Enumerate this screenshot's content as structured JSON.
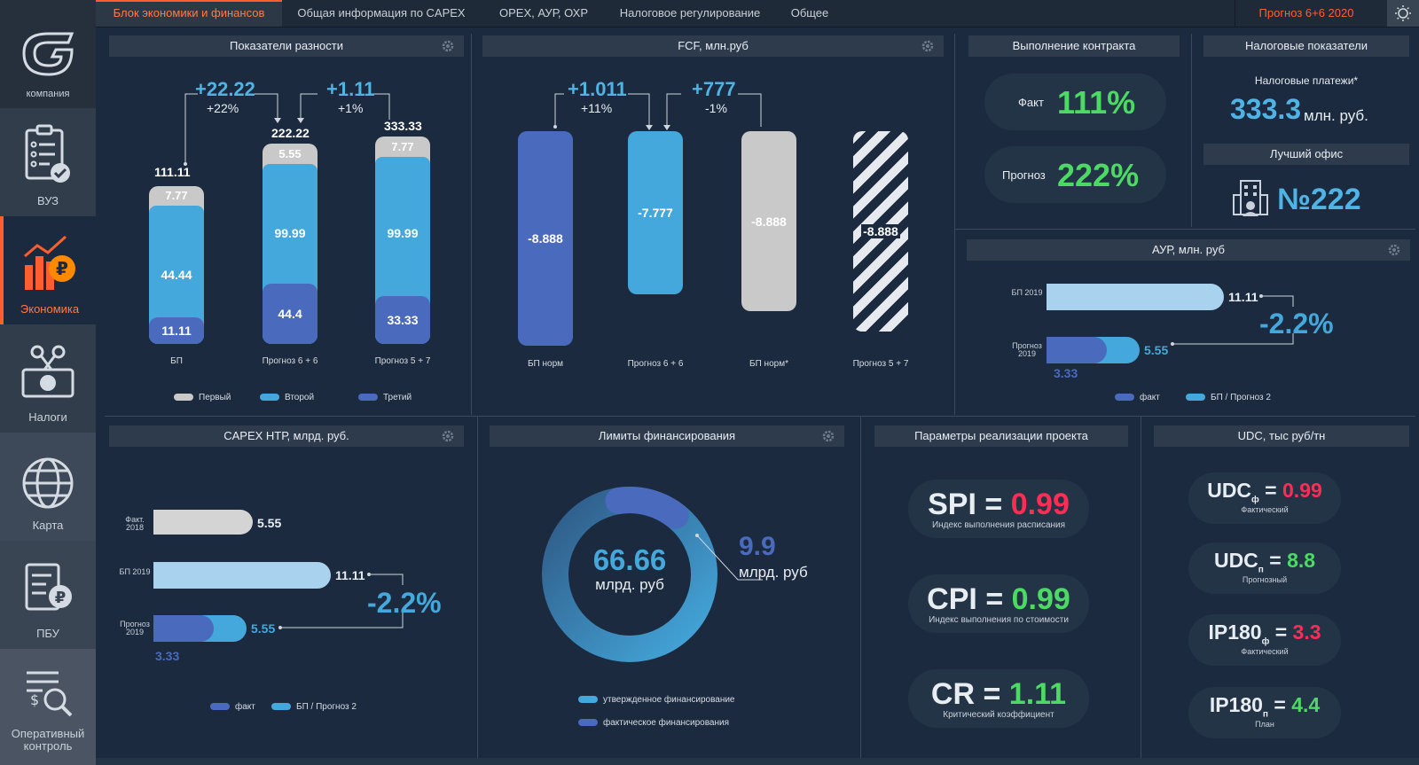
{
  "sidebar": {
    "logo_label": "компания",
    "items": [
      {
        "label": "ВУЗ"
      },
      {
        "label": "Экономика"
      },
      {
        "label": "Налоги"
      },
      {
        "label": "Карта"
      },
      {
        "label": "ПБУ"
      },
      {
        "label": "Оперативный контроль"
      }
    ]
  },
  "tabs": [
    {
      "label": "Блок экономики и финансов"
    },
    {
      "label": "Общая информация по CAPEX"
    },
    {
      "label": "OPEX, АУР, ОХР"
    },
    {
      "label": "Налоговое регулирование"
    },
    {
      "label": "Общее"
    }
  ],
  "forecast_label": "Прогноз 6+6 2020",
  "colors": {
    "accent": "#ff5f2e",
    "blue_light": "#4fb3e3",
    "blue_dark": "#4a6bbd",
    "grey": "#c9c9c9",
    "green": "#4cd964",
    "red": "#ff2d55"
  },
  "p1": {
    "title": "Показатели разности",
    "deltas": [
      {
        "v": "+22.22",
        "p": "+22%"
      },
      {
        "v": "+1.11",
        "p": "+1%"
      }
    ],
    "bars": [
      {
        "total": "111.11",
        "top": "7.77",
        "mid": "44.44",
        "bot": "11.11",
        "name": "БП"
      },
      {
        "total": "222.22",
        "top": "5.55",
        "mid": "99.99",
        "bot": "44.4",
        "name": "Прогноз 6 + 6"
      },
      {
        "total": "333.33",
        "top": "7.77",
        "mid": "99.99",
        "bot": "33.33",
        "name": "Прогноз 5 + 7"
      }
    ],
    "legend": [
      "Первый",
      "Второй",
      "Третий"
    ]
  },
  "p2": {
    "title": "FCF, млн.руб",
    "deltas": [
      {
        "v": "+1.011",
        "p": "+11%"
      },
      {
        "v": "+777",
        "p": "-1%"
      }
    ],
    "bars": [
      {
        "v": "-8.888",
        "name": "БП норм"
      },
      {
        "v": "-7.777",
        "name": "Прогноз 6 + 6"
      },
      {
        "v": "-8.888",
        "name": "БП норм*"
      },
      {
        "v": "-8.888",
        "name": "Прогноз 5 + 7"
      }
    ]
  },
  "p3": {
    "title": "Выполнение контракта",
    "fact_label": "Факт",
    "fact_value": "111%",
    "forecast_label": "Прогноз",
    "forecast_value": "222%"
  },
  "p4": {
    "title": "Налоговые показатели",
    "payments_label": "Налоговые платежи*",
    "payments_value": "333.3",
    "payments_unit": "млн. руб.",
    "office_title": "Лучший офис",
    "office_value": "№222"
  },
  "p5": {
    "title": "АУР, млн. руб",
    "row1_label": "БП 2019",
    "row1_value": "11.11",
    "row2_label": "Прогноз 2019",
    "row2_value": "5.55",
    "row2_sub": "3.33",
    "delta": "-2.2%",
    "legend": [
      "факт",
      "БП / Прогноз 2"
    ]
  },
  "p6": {
    "title": "CAPEX НТР, млрд. руб.",
    "row0_label": "Факт. 2018",
    "row0_value": "5.55",
    "row1_label": "БП 2019",
    "row1_value": "11.11",
    "row2_label": "Прогноз 2019",
    "row2_value": "5.55",
    "row2_sub": "3.33",
    "delta": "-2.2%",
    "legend": [
      "факт",
      "БП / Прогноз 2"
    ]
  },
  "p7": {
    "title": "Лимиты финансирования",
    "center_value": "66.66",
    "center_unit": "млрд. руб",
    "side_value": "9.9",
    "side_unit": "млрд. руб",
    "approved_share": 0.871,
    "legend": [
      "утвержденное финансирование",
      "фактическое финансирования"
    ]
  },
  "p8": {
    "title": "Параметры реализации проекта",
    "metrics": [
      {
        "name": "SPI",
        "eq": "=",
        "value": "0.99",
        "desc": "Индекс выполнения расписания",
        "color": "#ff2d55"
      },
      {
        "name": "CPI",
        "eq": "=",
        "value": "0.99",
        "desc": "Индекс выполнения по стоимости",
        "color": "#4cd964"
      },
      {
        "name": "CR",
        "eq": "=",
        "value": "1.11",
        "desc": "Критический коэффициент",
        "color": "#4cd964"
      }
    ]
  },
  "p9": {
    "title": "UDC, тыс руб/тн",
    "items": [
      {
        "name": "UDC",
        "sub": "ф",
        "value": "0.99",
        "desc": "Фактический",
        "color": "#ff2d55"
      },
      {
        "name": "UDC",
        "sub": "п",
        "value": "8.8",
        "desc": "Прогнозный",
        "color": "#4cd964"
      },
      {
        "name": "IP180",
        "sub": "ф",
        "value": "3.3",
        "desc": "Фактический",
        "color": "#ff2d55"
      },
      {
        "name": "IP180",
        "sub": "п",
        "value": "4.4",
        "desc": "План",
        "color": "#4cd964"
      }
    ]
  }
}
